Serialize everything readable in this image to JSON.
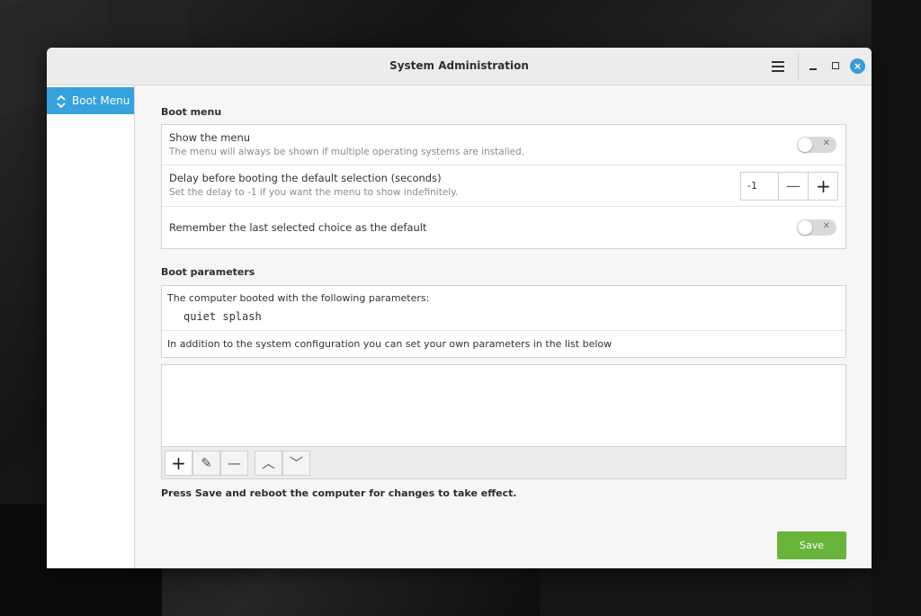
{
  "window": {
    "title": "System Administration"
  },
  "sidebar": {
    "items": [
      {
        "label": "Boot Menu",
        "icon": "chevron-up-down-icon",
        "selected": true
      }
    ]
  },
  "boot_menu": {
    "heading": "Boot menu",
    "show_menu": {
      "title": "Show the menu",
      "subtitle": "The menu will always be shown if multiple operating systems are installed.",
      "enabled": false
    },
    "delay": {
      "title": "Delay before booting the default selection (seconds)",
      "subtitle": "Set the delay to -1 if you want the menu to show indefinitely.",
      "value": "-1",
      "minus_label": "—",
      "plus_label": "+"
    },
    "remember": {
      "title": "Remember the last selected choice as the default",
      "enabled": false
    }
  },
  "boot_parameters": {
    "heading": "Boot parameters",
    "booted_with": "The computer booted with the following parameters:",
    "parameters": "quiet splash",
    "info": "In addition to the system configuration you can set your own parameters in the list below",
    "list_items": [],
    "toolbar": {
      "add_label": "+",
      "edit_label": "✎",
      "remove_label": "—",
      "up_label": "︿",
      "down_label": "﹀"
    }
  },
  "footer": {
    "note": "Press Save and reboot the computer for changes to take effect.",
    "save_label": "Save"
  },
  "colors": {
    "accent": "#35a2dc",
    "save": "#69b53c",
    "close": "#3a9bd9"
  }
}
